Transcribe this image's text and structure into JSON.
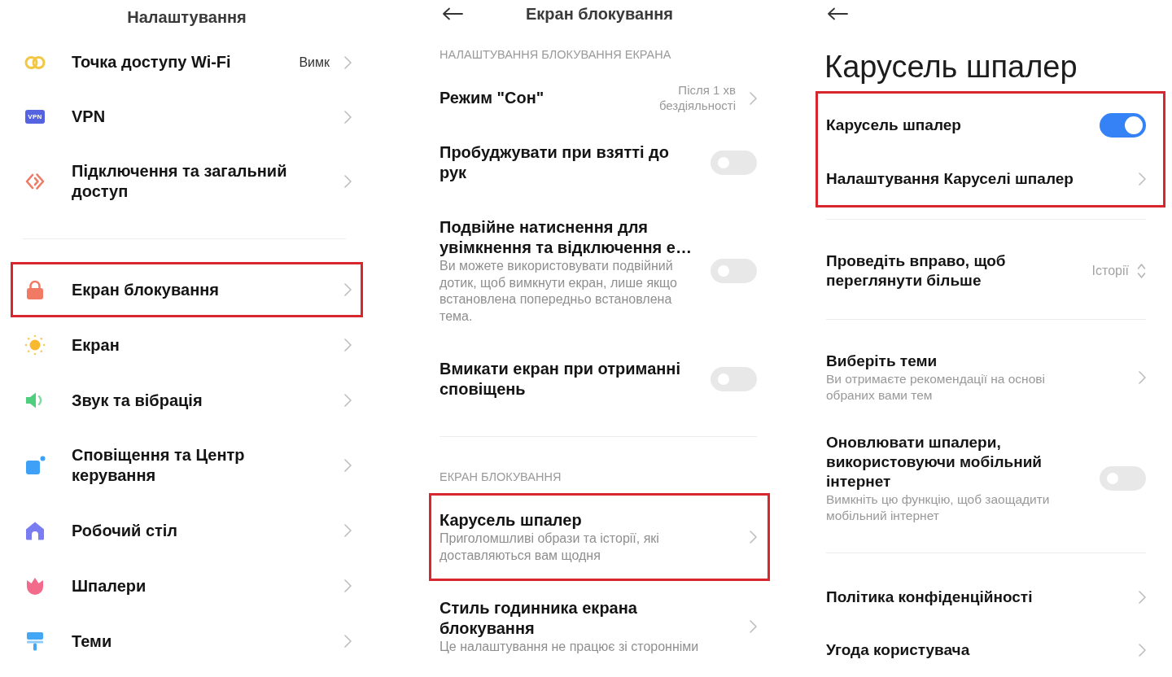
{
  "settings": {
    "title": "Налаштування",
    "groups": [
      {
        "items": [
          {
            "label": "Точка доступу Wi-Fi",
            "value": "Вимк",
            "highlighted": false
          },
          {
            "label": "VPN",
            "icon_text": "VPN",
            "highlighted": false
          },
          {
            "label": "Підключення та загальний доступ",
            "highlighted": false
          }
        ]
      },
      {
        "items": [
          {
            "label": "Екран блокування",
            "highlighted": true
          },
          {
            "label": "Екран",
            "highlighted": false
          },
          {
            "label": "Звук та вібрація",
            "highlighted": false
          },
          {
            "label": "Сповіщення та Центр керування",
            "highlighted": false
          },
          {
            "label": "Робочий стіл",
            "highlighted": false
          },
          {
            "label": "Шпалери",
            "highlighted": false
          },
          {
            "label": "Теми",
            "highlighted": false
          }
        ]
      }
    ]
  },
  "lock_screen": {
    "title": "Екран блокування",
    "sections": [
      {
        "header": "НАЛАШТУВАННЯ БЛОКУВАННЯ ЕКРАНА",
        "items": [
          {
            "kind": "link",
            "label": "Режим \"Сон\"",
            "value": "Після 1 хв бездіяльності",
            "highlighted": false
          },
          {
            "kind": "toggle",
            "label": "Пробуджувати при взятті до рук",
            "on": false,
            "highlighted": false
          },
          {
            "kind": "toggle",
            "label": "Подвійне натиснення для увімкнення та відключення е…",
            "subtitle": "Ви можете використовувати подвійний дотик, щоб вимкнути екран, лише якщо встановлена попередньо встановлена тема.",
            "on": false,
            "highlighted": false
          },
          {
            "kind": "toggle",
            "label": "Вмикати екран при отриманні сповіщень",
            "on": false,
            "highlighted": false
          }
        ]
      },
      {
        "header": "ЕКРАН БЛОКУВАННЯ",
        "items": [
          {
            "kind": "link",
            "label": "Карусель шпалер",
            "subtitle": "Приголомшливі образи та історії, які доставляються вам щодня",
            "highlighted": true
          },
          {
            "kind": "link",
            "label": "Стиль годинника екрана блокування",
            "subtitle": "Це налаштування не працює зі сторонніми",
            "highlighted": false
          }
        ]
      }
    ]
  },
  "wallpaper_carousel": {
    "title": "Карусель шпалер",
    "sections": [
      {
        "highlighted": true,
        "items": [
          {
            "kind": "toggle",
            "label": "Карусель шпалер",
            "on": true
          },
          {
            "kind": "link",
            "label": "Налаштування Каруселі шпалер"
          }
        ]
      },
      {
        "highlighted": false,
        "items": [
          {
            "kind": "select",
            "label": "Проведіть вправо, щоб переглянути більше",
            "value": "Історії"
          }
        ]
      },
      {
        "highlighted": false,
        "items": [
          {
            "kind": "link",
            "label": "Виберіть теми",
            "subtitle": "Ви отримаєте рекомендації на основі обраних вами тем"
          },
          {
            "kind": "toggle",
            "label": "Оновлювати шпалери, використовуючи мобільний інтернет",
            "subtitle": "Вимкніть цю функцію, щоб заощадити мобільний інтернет",
            "on": false
          }
        ]
      },
      {
        "highlighted": false,
        "items": [
          {
            "kind": "link",
            "label": "Політика конфіденційності"
          },
          {
            "kind": "link",
            "label": "Угода користувача"
          }
        ]
      }
    ]
  }
}
